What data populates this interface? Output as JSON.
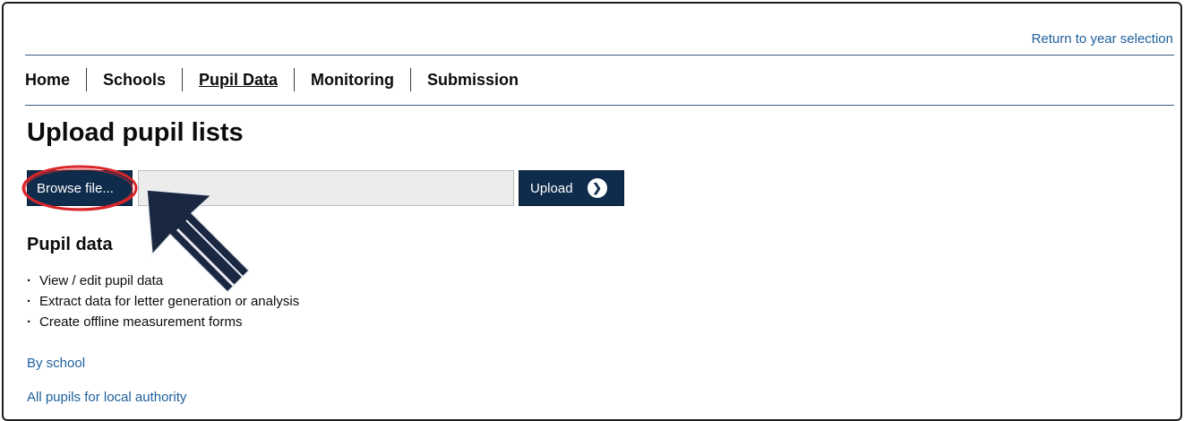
{
  "header": {
    "return_link": "Return to year selection"
  },
  "nav": {
    "items": [
      {
        "label": "Home",
        "active": false
      },
      {
        "label": "Schools",
        "active": false
      },
      {
        "label": "Pupil Data",
        "active": true
      },
      {
        "label": "Monitoring",
        "active": false
      },
      {
        "label": "Submission",
        "active": false
      }
    ]
  },
  "page": {
    "title": "Upload pupil lists"
  },
  "upload": {
    "browse_label": "Browse file...",
    "file_value": "",
    "upload_label": "Upload",
    "upload_icon": "chevron-right-circle-icon"
  },
  "annotation": {
    "highlight_color": "#d9262b",
    "arrow_color": "#1a2740"
  },
  "pupil_data": {
    "title": "Pupil data",
    "bullets": [
      "View / edit pupil data",
      "Extract data for letter generation or analysis",
      "Create offline measurement forms"
    ]
  },
  "links": {
    "by_school": "By school",
    "all_pupils": "All pupils for local authority"
  },
  "colors": {
    "dark_navy": "#0f2c4c",
    "link_blue": "#1d5f9c",
    "rule": "#3a5f86"
  }
}
